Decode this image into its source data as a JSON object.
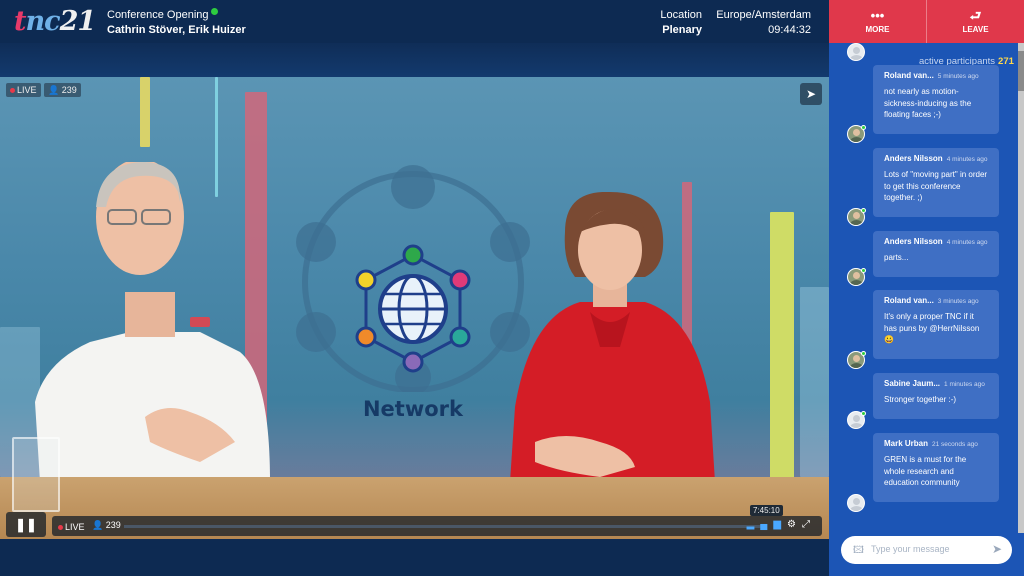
{
  "header": {
    "logo": {
      "part1": "t",
      "part2": "nc",
      "part3": "21"
    },
    "session_title": "Conference Opening",
    "session_speakers": "Cathrin Stöver, Erik Huizer",
    "location_label": "Location",
    "location_value": "Plenary",
    "timezone_label": "Europe/Amsterdam",
    "clock": "09:44:32",
    "more_label": "MORE",
    "leave_label": "LEAVE"
  },
  "video": {
    "live_label": "LIVE",
    "viewer_count": "239",
    "network_label": "Network",
    "controls": {
      "live_label": "LIVE",
      "viewer_count": "239",
      "time_tooltip": "7:45:10"
    }
  },
  "chat": {
    "active_label": "active participants",
    "active_count": "271",
    "messages": [
      {
        "name": "Roland van...",
        "time": "5 minutes ago",
        "text": "not nearly as motion-sickness-inducing as the floating faces ;-)"
      },
      {
        "name": "Anders Nilsson",
        "time": "4 minutes ago",
        "text": "Lots of \"moving part\" in order to get this conference together. ;)"
      },
      {
        "name": "Anders Nilsson",
        "time": "4 minutes ago",
        "text": "parts..."
      },
      {
        "name": "Roland van...",
        "time": "3 minutes ago",
        "text": "It's only a proper TNC if it has puns by @HerrNilsson 😀"
      },
      {
        "name": "Sabine Jaum...",
        "time": "1 minutes ago",
        "text": "Stronger together :-)"
      },
      {
        "name": "Mark Urban",
        "time": "21 seconds ago",
        "text": "GREN is a must for the whole research and education community"
      }
    ],
    "input_placeholder": "Type your message"
  },
  "colors": {
    "accent_red": "#e0384b",
    "sidebar_blue": "#1c55b5",
    "bubble_blue": "#3f6fc4",
    "header_navy": "#0d2a52"
  }
}
